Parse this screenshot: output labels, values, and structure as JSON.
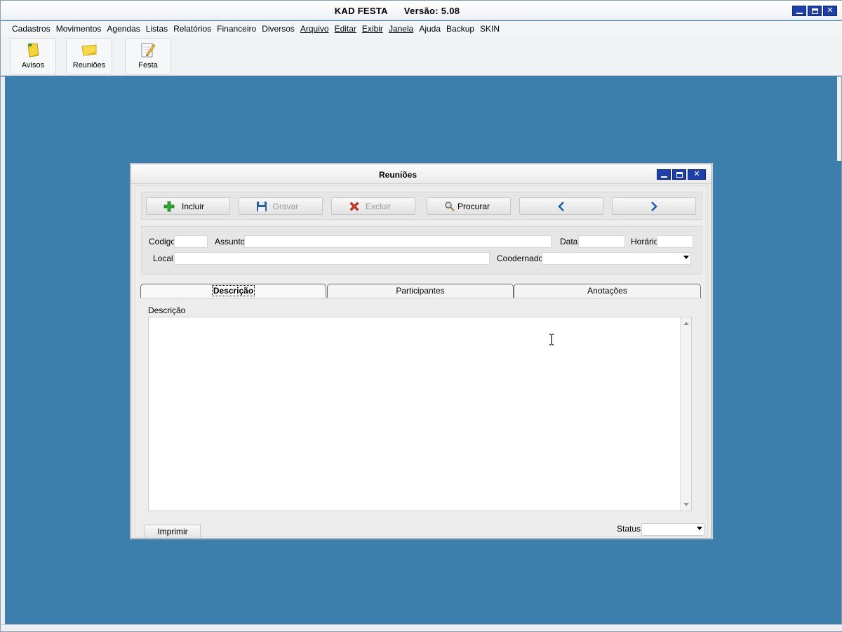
{
  "app": {
    "title": "KAD FESTA      Versão: 5.08"
  },
  "menu": [
    "Cadastros",
    "Movimentos",
    "Agendas",
    "Listas",
    "Relatórios",
    "Financeiro",
    "Diversos",
    "Arquivo",
    "Editar",
    "Exibir",
    "Janela",
    "Ajuda",
    "Backup",
    "SKIN"
  ],
  "toolbar": {
    "avisos": {
      "label": "Avisos",
      "icon": "sticky-note-pin-icon"
    },
    "reunioes": {
      "label": "Reuniões",
      "icon": "sticky-note-icon"
    },
    "festa": {
      "label": "Festa",
      "icon": "notepad-pencil-icon"
    }
  },
  "dialog": {
    "title": "Reuniões",
    "actions": {
      "incluir": "Incluir",
      "gravar": "Gravar",
      "excluir": "Excluir",
      "procurar": "Procurar"
    },
    "fields": {
      "codigo": {
        "label": "Codigo",
        "value": ""
      },
      "assunto": {
        "label": "Assunto",
        "value": ""
      },
      "data": {
        "label": "Data",
        "value": ""
      },
      "horario": {
        "label": "Horário",
        "value": ""
      },
      "local": {
        "label": "Local",
        "value": ""
      },
      "coordenador": {
        "label": "Coodernador",
        "value": ""
      }
    },
    "tabs": {
      "descricao": "Descrição",
      "participantes": "Participantes",
      "anotacoes": "Anotações"
    },
    "description": {
      "label": "Descrição",
      "value": ""
    },
    "footer": {
      "print": "Imprimir",
      "status_label": "Status",
      "status_value": ""
    }
  },
  "colors": {
    "desktop": "#3d7fac",
    "title_buttons": "#1f3fa8",
    "add_icon": "#2fa52f",
    "delete_icon": "#d23a2a",
    "nav_arrow": "#1f5fb0"
  }
}
